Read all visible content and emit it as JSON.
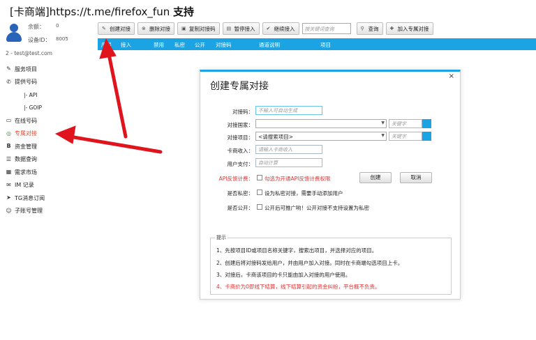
{
  "header_title": {
    "prefix": "[卡商端]",
    "url": "https://t.me/firefox_fun",
    "suffix": "支持"
  },
  "account": {
    "balance_label": "余额：",
    "balance_value": "0",
    "device_label": "设备ID：",
    "device_value": "8005",
    "user_line": "2 - test@test.com"
  },
  "sidebar": {
    "items": [
      {
        "label": "服务项目",
        "icon": "wrench-icon",
        "glyph": "✎"
      },
      {
        "label": "提供号码",
        "icon": "phone-icon",
        "glyph": "✆"
      },
      {
        "label": "|-  API",
        "icon": "",
        "glyph": ""
      },
      {
        "label": "|-  GOIP",
        "icon": "",
        "glyph": ""
      },
      {
        "label": "在线号码",
        "icon": "window-icon",
        "glyph": "▭"
      },
      {
        "label": "专属对接",
        "icon": "globe-icon",
        "glyph": "◎"
      },
      {
        "label": "资金管理",
        "icon": "bitcoin-icon",
        "glyph": "B"
      },
      {
        "label": "数据查询",
        "icon": "list-icon",
        "glyph": "☰"
      },
      {
        "label": "需求市场",
        "icon": "grid-icon",
        "glyph": "▦"
      },
      {
        "label": "IM 记录",
        "icon": "mail-icon",
        "glyph": "✉"
      },
      {
        "label": "TG消息订阅",
        "icon": "telegram-icon",
        "glyph": "➤"
      },
      {
        "label": "子账号管理",
        "icon": "users-icon",
        "glyph": "☺"
      }
    ],
    "active_color": "#e54b2e"
  },
  "toolbar": {
    "create": "创建对接",
    "delete": "删除对接",
    "copy": "复制对接码",
    "pause": "暂停接入",
    "resume": "继续接入",
    "search_placeholder": "按关键词查询",
    "query": "查询",
    "add_exclusive": "加入专属对接"
  },
  "grid": {
    "columns": [
      "序号",
      "接入",
      "禁用",
      "私密",
      "公开",
      "对接码",
      "通道说明",
      "项目"
    ],
    "header_color": "#1ba3e3"
  },
  "dialog": {
    "title": "创建专属对接",
    "close": "×",
    "fields": {
      "code_label": "对接码：",
      "code_placeholder": "不输入可自动生成",
      "country_label": "对接国家：",
      "country_value": "",
      "country_keyword": "关键字",
      "project_label": "对接项目：",
      "project_value": "<请搜索项目>",
      "project_keyword": "关键字",
      "income_label": "卡商收入：",
      "income_placeholder": "请输入卡商收入",
      "pay_label": "用户支付：",
      "pay_placeholder": "自动计算",
      "api_label": "API反馈计费：",
      "api_text": "勾选为开通API反馈计费权限",
      "private_label": "是否私密：",
      "private_text": "设为私密对接，需要手动添加用户",
      "public_label": "是否公开：",
      "public_text": "公开后可推广哟！公开对接不支持设置为私密"
    },
    "buttons": {
      "create": "创建",
      "cancel": "取消"
    },
    "tips": {
      "title": "提示",
      "items": [
        "1、先按项目ID或项目名称关键字，搜索出项目，并选择对应的项目。",
        "2、创建后将对接码发给用户，并由用户加入对接。同时在卡商端勾选项目上卡。",
        "3、对接后，卡商该项目的卡只能由加入对接的用户使用。",
        "4、卡商价为0即线下结算，线下结算引起的资金纠纷，平台概不负责。"
      ]
    }
  },
  "annotation_color": "#e0141c"
}
